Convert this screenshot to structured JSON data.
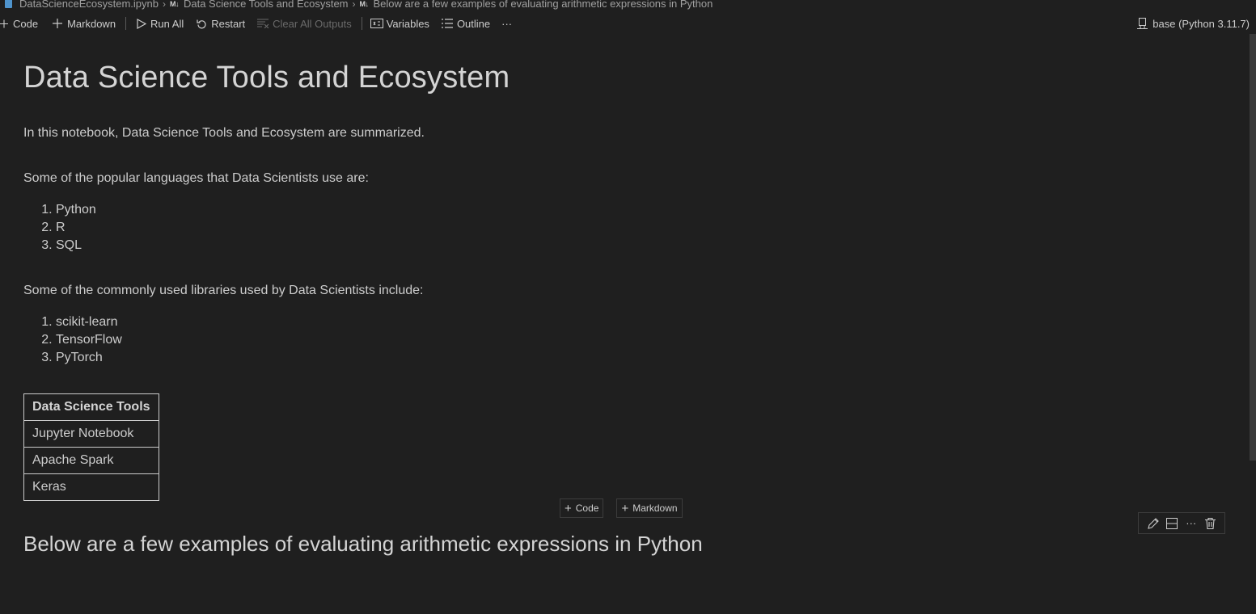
{
  "breadcrumb": {
    "file": "DataScienceEcosystem.ipynb",
    "md_badge": "M↓",
    "cell1": "Data Science Tools and Ecosystem",
    "cell2": "Below are a few examples of evaluating arithmetic expressions in Python"
  },
  "toolbar": {
    "code": "Code",
    "markdown": "Markdown",
    "run_all": "Run All",
    "restart": "Restart",
    "clear_outputs": "Clear All Outputs",
    "variables": "Variables",
    "outline": "Outline",
    "more": "···",
    "kernel": "base (Python 3.11.7)"
  },
  "notebook": {
    "title": "Data Science Tools and Ecosystem",
    "intro": "In this notebook, Data Science Tools and Ecosystem are summarized.",
    "languages_intro": "Some of the popular languages that Data Scientists use are:",
    "languages": [
      "Python",
      "R",
      "SQL"
    ],
    "libraries_intro": "Some of the commonly used libraries used by Data Scientists include:",
    "libraries": [
      "scikit-learn",
      "TensorFlow",
      "PyTorch"
    ],
    "tools_table": {
      "header": "Data Science Tools",
      "rows": [
        "Jupyter Notebook",
        "Apache Spark",
        "Keras"
      ]
    },
    "add_cell": {
      "code": "Code",
      "markdown": "Markdown"
    },
    "subheading": "Below are a few examples of evaluating arithmetic expressions in Python"
  },
  "icons": {
    "file": "notebook-file-icon",
    "plus": "plus-icon",
    "run": "play-icon",
    "restart": "restart-icon",
    "clear": "clear-outputs-icon",
    "variables": "variables-icon",
    "outline": "outline-icon",
    "kernel": "kernel-icon",
    "edit": "pencil-icon",
    "split": "split-cell-icon",
    "more": "more-icon",
    "delete": "trash-icon"
  },
  "colors": {
    "background": "#1f1f1f",
    "text": "#cccccc",
    "file_icon": "#4f94cd"
  }
}
